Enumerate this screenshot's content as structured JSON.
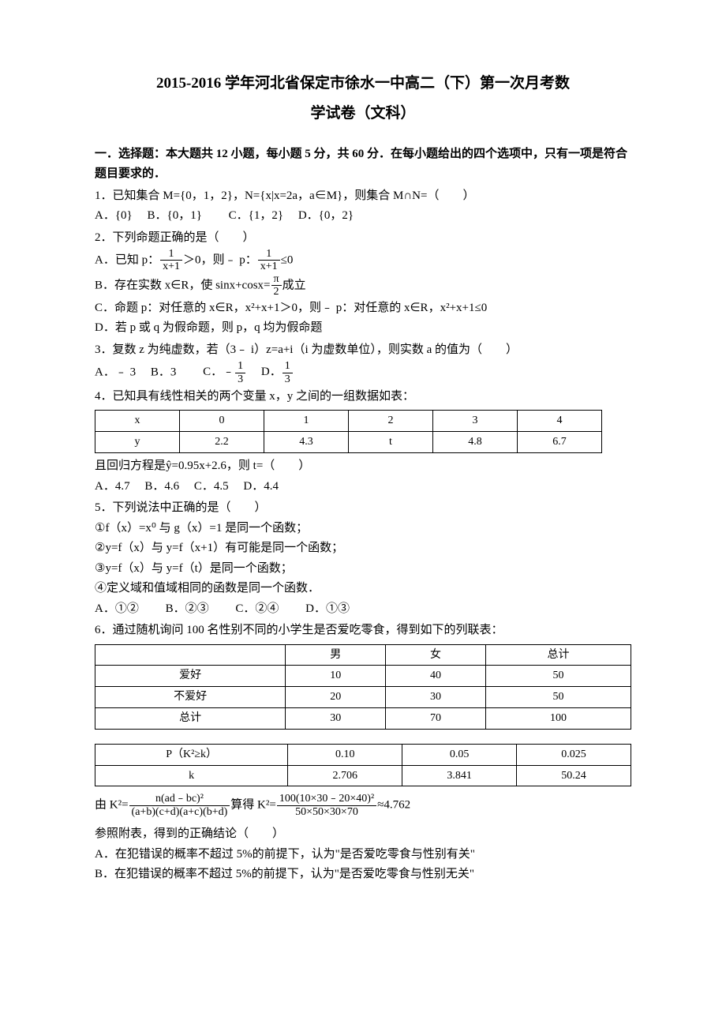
{
  "title_line1": "2015-2016 学年河北省保定市徐水一中高二（下）第一次月考数",
  "title_line2": "学试卷（文科）",
  "section_heading_1": "一．选择题：本大题共 12 小题，每小题 5 分，共 60 分．在每小题给出的四个选项中，只有一项是符合题目要求的．",
  "q1": {
    "stem": "1．已知集合 M={0，1，2}，N={x|x=2a，a∈M}，则集合 M∩N=（　　）",
    "A": "A．{0}",
    "B": "B．{0，1}",
    "C": "C．{1，2}",
    "D": "D．{0，2}"
  },
  "q2": {
    "stem": "2．下列命题正确的是（　　）",
    "A_pre": "A．已知 p：",
    "A_frac_num": "1",
    "A_frac_den": "x+1",
    "A_mid": "＞0，则﹣ p：",
    "A_frac2_num": "1",
    "A_frac2_den": "x+1",
    "A_post": "≤0",
    "B_pre": "B．存在实数 x∈R，使 sinx+cosx=",
    "B_frac_num": "π",
    "B_frac_den": "2",
    "B_post": "成立",
    "C": "C．命题 p：对任意的 x∈R，x²+x+1＞0，则﹣ p：对任意的 x∈R，x²+x+1≤0",
    "D": "D．若 p 或 q 为假命题，则 p，q 均为假命题"
  },
  "q3": {
    "stem": "3．复数 z 为纯虚数，若（3﹣ i）z=a+i（i 为虚数单位），则实数 a 的值为（　　）",
    "A": "A．﹣ 3",
    "B": "B．3",
    "C_pre": "C．﹣",
    "C_num": "1",
    "C_den": "3",
    "D_pre": "D．",
    "D_num": "1",
    "D_den": "3"
  },
  "q4": {
    "stem": "4．已知具有线性相关的两个变量 x，y 之间的一组数据如表：",
    "table_header": [
      "x",
      "0",
      "1",
      "2",
      "3",
      "4"
    ],
    "table_row": [
      "y",
      "2.2",
      "4.3",
      "t",
      "4.8",
      "6.7"
    ],
    "line2_pre": "且回归方程是",
    "line2_hat": "ŷ",
    "line2_post": "=0.95x+2.6，则 t=（　　）",
    "A": "A．4.7",
    "B": "B．4.6",
    "C": "C．4.5",
    "D": "D．4.4"
  },
  "q5": {
    "stem": "5．下列说法中正确的是（　　）",
    "o1": "①f（x）=x⁰ 与 g（x）=1 是同一个函数；",
    "o2": "②y=f（x）与 y=f（x+1）有可能是同一个函数；",
    "o3": "③y=f（x）与 y=f（t）是同一个函数；",
    "o4": "④定义域和值域相同的函数是同一个函数．",
    "A": "A．①②",
    "B": "B．②③",
    "C": "C．②④",
    "D": "D．①③"
  },
  "q6": {
    "stem": "6．通过随机询问 100 名性别不同的小学生是否爱吃零食，得到如下的列联表：",
    "table1": {
      "header": [
        "",
        "男",
        "女",
        "总计"
      ],
      "rows": [
        [
          "爱好",
          "10",
          "40",
          "50"
        ],
        [
          "不爱好",
          "20",
          "30",
          "50"
        ],
        [
          "总计",
          "30",
          "70",
          "100"
        ]
      ]
    },
    "table2": {
      "rows": [
        [
          "P（K²≥k）",
          "0.10",
          "0.05",
          "0.025"
        ],
        [
          "k",
          "2.706",
          "3.841",
          "50.24"
        ]
      ]
    },
    "formula_pre": "由 K²=",
    "formula_num": "n(ad﹣bc)²",
    "formula_den": "(a+b)(c+d)(a+c)(b+d)",
    "formula_mid": "算得 K²=",
    "formula2_num": "100(10×30﹣20×40)²",
    "formula2_den": "50×50×30×70",
    "formula_post": "≈4.762",
    "line2": "参照附表，得到的正确结论（　　）",
    "A": "A．在犯错误的概率不超过 5%的前提下，认为\"是否爱吃零食与性别有关\"",
    "B": "B．在犯错误的概率不超过 5%的前提下，认为\"是否爱吃零食与性别无关\""
  },
  "chart_data": [
    {
      "type": "table",
      "title": "Q4 data table",
      "categories": [
        "x",
        "y"
      ],
      "series": [
        {
          "name": "x",
          "values": [
            0,
            1,
            2,
            3,
            4
          ]
        },
        {
          "name": "y",
          "values": [
            2.2,
            4.3,
            "t",
            4.8,
            6.7
          ]
        }
      ]
    },
    {
      "type": "table",
      "title": "Q6 contingency table",
      "columns": [
        "",
        "男",
        "女",
        "总计"
      ],
      "rows": [
        [
          "爱好",
          10,
          40,
          50
        ],
        [
          "不爱好",
          20,
          30,
          50
        ],
        [
          "总计",
          30,
          70,
          100
        ]
      ]
    },
    {
      "type": "table",
      "title": "Q6 critical values",
      "columns": [
        "P(K²≥k)",
        0.1,
        0.05,
        0.025
      ],
      "rows": [
        [
          "k",
          2.706,
          3.841,
          50.24
        ]
      ]
    }
  ]
}
